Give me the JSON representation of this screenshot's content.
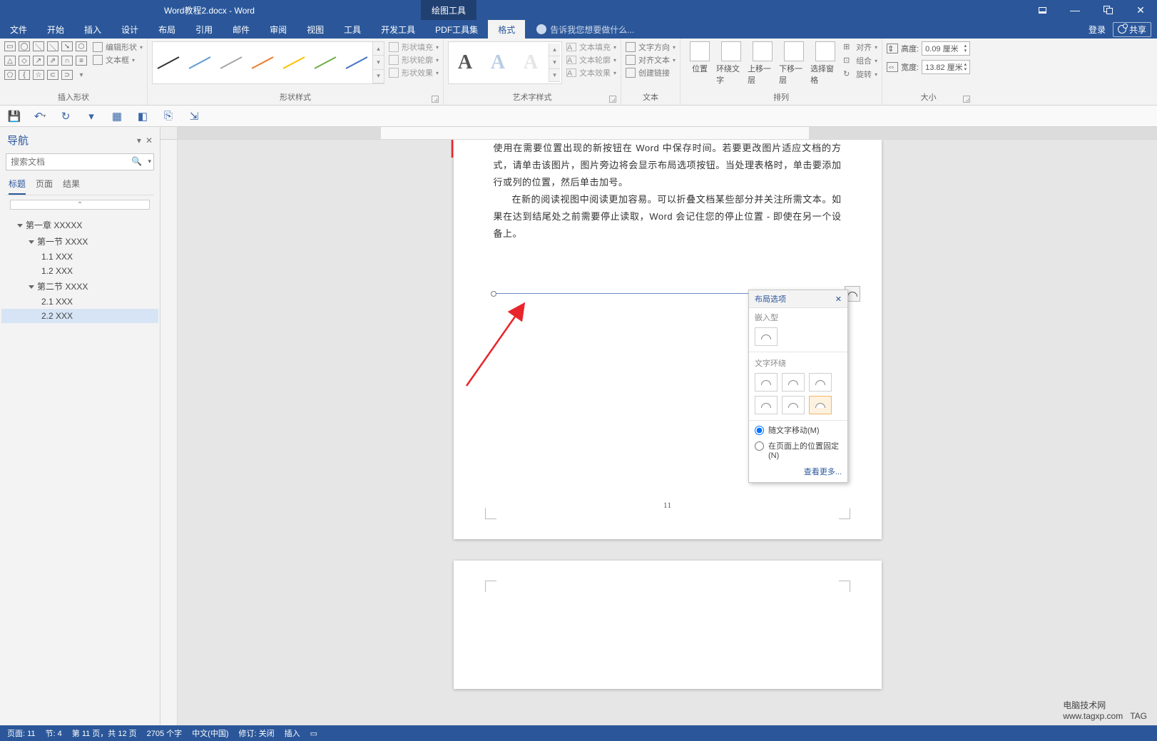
{
  "titlebar": {
    "doc": "Word教程2.docx - Word",
    "context_tool": "绘图工具"
  },
  "tabs": {
    "items": [
      "文件",
      "开始",
      "插入",
      "设计",
      "布局",
      "引用",
      "邮件",
      "审阅",
      "视图",
      "工具",
      "开发工具",
      "PDF工具集",
      "格式"
    ],
    "active": "格式",
    "tell_me": "告诉我您想要做什么...",
    "login": "登录",
    "share": "共享"
  },
  "ribbon": {
    "g_shapes": {
      "label": "插入形状",
      "edit_shape": "编辑形状",
      "text_box": "文本框"
    },
    "g_styles": {
      "label": "形状样式",
      "fill": "形状填充",
      "outline": "形状轮廓",
      "effects": "形状效果",
      "colors": [
        "#333333",
        "#5b9bd5",
        "#a5a5a5",
        "#ed7d31",
        "#ffc000",
        "#70ad47",
        "#4472c4"
      ]
    },
    "g_wordart": {
      "label": "艺术字样式",
      "fill": "文本填充",
      "outline": "文本轮廓",
      "effects": "文本效果",
      "styles": [
        {
          "c": "#555",
          "o": "0.9"
        },
        {
          "c": "#7aa7d8",
          "o": "0.55"
        },
        {
          "c": "#c9c9c9",
          "o": "0.45"
        }
      ]
    },
    "g_text": {
      "label": "文本",
      "dir": "文字方向",
      "align": "对齐文本",
      "link": "创建链接"
    },
    "g_arrange": {
      "label": "排列",
      "position": "位置",
      "wrap": "环绕文字",
      "forward": "上移一层",
      "backward": "下移一层",
      "selection": "选择窗格",
      "align": "对齐",
      "group": "组合",
      "rotate": "旋转"
    },
    "g_size": {
      "label": "大小",
      "height": "高度:",
      "width": "宽度:",
      "h_val": "0.09 厘米",
      "w_val": "13.82 厘米"
    }
  },
  "nav": {
    "title": "导航",
    "search_placeholder": "搜索文档",
    "tabs": {
      "headings": "标题",
      "pages": "页面",
      "results": "结果"
    },
    "tree": [
      {
        "lvl": 1,
        "txt": "第一章 XXXXX"
      },
      {
        "lvl": 2,
        "txt": "第一节 XXXX"
      },
      {
        "lvl": 3,
        "txt": "1.1 XXX"
      },
      {
        "lvl": 3,
        "txt": "1.2 XXX"
      },
      {
        "lvl": 2,
        "txt": "第二节 XXXX"
      },
      {
        "lvl": 3,
        "txt": "2.1 XXX"
      },
      {
        "lvl": 3,
        "txt": "2.2 XXX",
        "sel": true
      }
    ]
  },
  "doc": {
    "p1": "使用在需要位置出现的新按钮在 Word 中保存时间。若要更改图片适应文档的方式，请单击该图片，图片旁边将会显示布局选项按钮。当处理表格时，单击要添加行或列的位置，然后单击加号。",
    "p2": "在新的阅读视图中阅读更加容易。可以折叠文档某些部分并关注所需文本。如果在达到结尾处之前需要停止读取，Word 会记住您的停止位置 - 即使在另一个设备上。",
    "page_number": "11"
  },
  "layout_popup": {
    "title": "布局选项",
    "inline": "嵌入型",
    "wrap": "文字环绕",
    "move_with_text": "随文字移动(M)",
    "fixed": "在页面上的位置固定(N)",
    "more": "查看更多..."
  },
  "status": {
    "page": "页面: 11",
    "section": "节: 4",
    "page_of": "第 11 页，共 12 页",
    "words": "2705 个字",
    "lang": "中文(中国)",
    "track": "修订: 关闭",
    "insert": "插入"
  },
  "watermark": {
    "l1": "电脑技术网",
    "l2": "www.tagxp.com",
    "tag": "TAG"
  }
}
